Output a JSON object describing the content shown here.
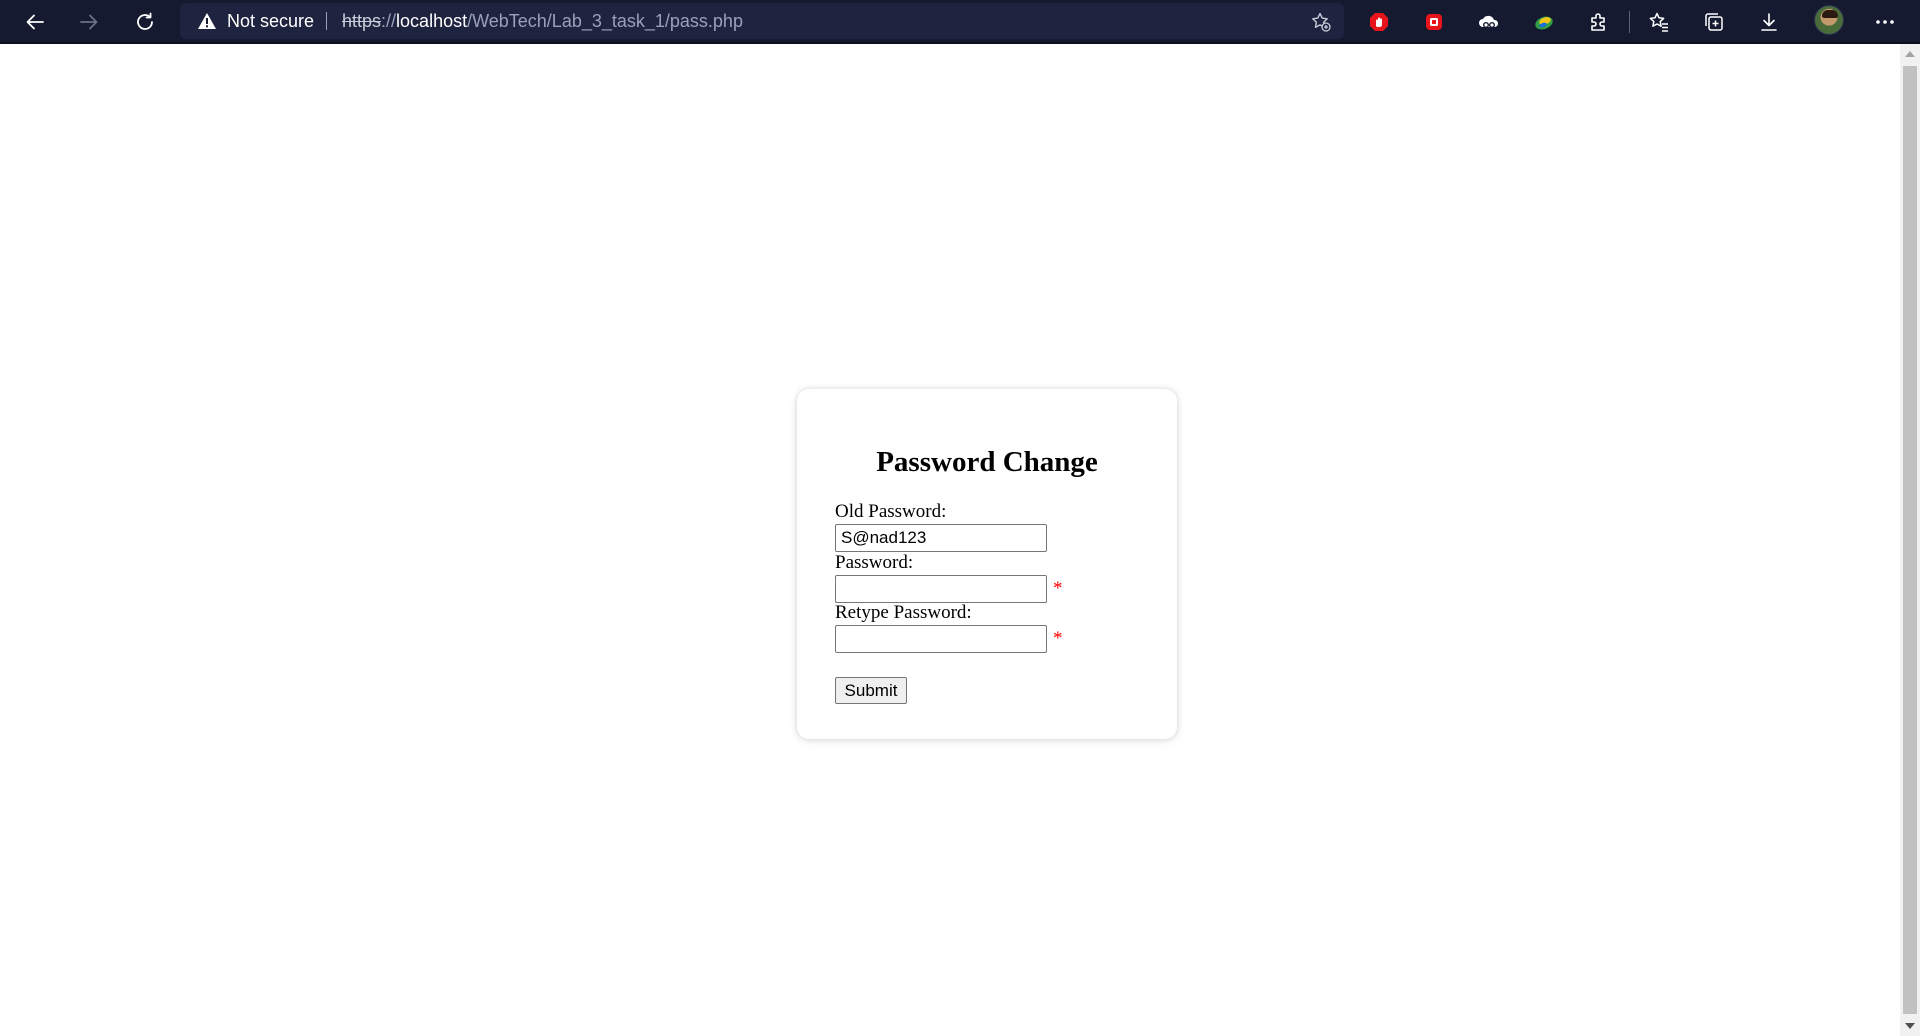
{
  "browser": {
    "security_label": "Not secure",
    "url": {
      "scheme": "https",
      "separator": "://",
      "host": "localhost",
      "path": "/WebTech/Lab_3_task_1/pass.php"
    },
    "icons": {
      "back": "back-arrow-icon",
      "forward": "forward-arrow-icon",
      "refresh": "refresh-icon",
      "warning": "warning-icon",
      "add_favorite": "add-favorite-icon",
      "extensions": [
        "adblock-icon",
        "pdf-extension-icon",
        "cloud-extension-icon",
        "edge-extension-icon",
        "puzzle-extensions-icon"
      ],
      "favorites": "favorites-icon",
      "collections": "collections-icon",
      "downloads": "download-icon",
      "profile": "profile-avatar",
      "menu": "more-menu-icon"
    },
    "colors": {
      "toolbar_bg": "#151a30",
      "address_bg": "#1e2340"
    }
  },
  "form": {
    "title": "Password Change",
    "old_password": {
      "label": "Old Password:",
      "value": "S@nad123"
    },
    "new_password": {
      "label": "Password:",
      "value": "",
      "required_mark": "*"
    },
    "retype_password": {
      "label": "Retype Password:",
      "value": "",
      "required_mark": "*"
    },
    "submit_label": "Submit",
    "colors": {
      "required": "#ff0000"
    }
  }
}
